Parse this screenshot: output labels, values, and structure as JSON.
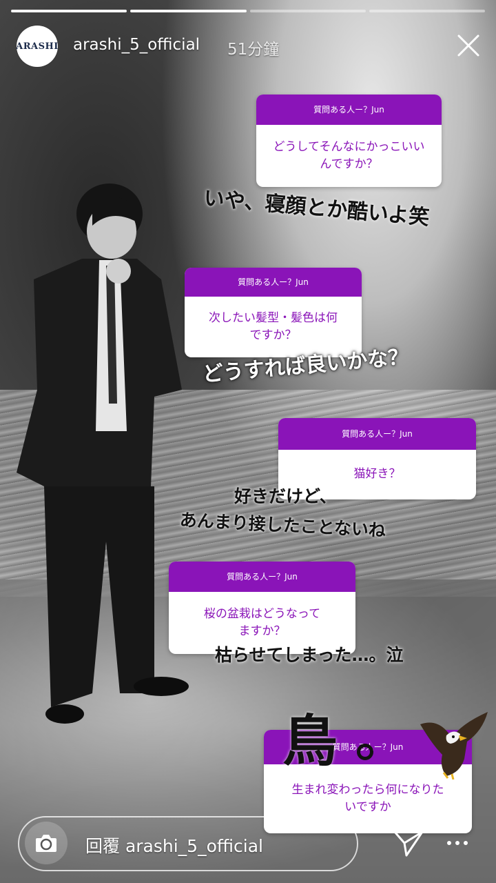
{
  "story": {
    "segments": 4,
    "segments_viewed": 2,
    "username": "arashi_5_official",
    "time_ago": "51分鐘",
    "avatar_text": "ARASHI"
  },
  "question_header": "質問ある人ー？Jun",
  "questions": [
    {
      "header": "質問ある人ー？Jun",
      "text_line1": "どうしてそんなにかっこいい",
      "text_line2": "んですか？"
    },
    {
      "header": "質問ある人ー？Jun",
      "text_line1": "次したい髪型・髪色は何",
      "text_line2": "ですか？"
    },
    {
      "header": "質問ある人ー？Jun",
      "text_line1": "猫好き？",
      "text_line2": ""
    },
    {
      "header": "質問ある人ー？Jun",
      "text_line1": "桜の盆栽はどうなって",
      "text_line2": "ますか？"
    },
    {
      "header": "質問ある人ー？Jun",
      "text_line1": "生まれ変わったら何になりた",
      "text_line2": "いですか"
    }
  ],
  "answers": [
    {
      "line1": "いや、寝顔とか酷いよ笑",
      "line2": ""
    },
    {
      "line1": "どうすれば良いかな？",
      "line2": ""
    },
    {
      "line1": "好きだけど、",
      "line2": "あんまり接したことないね"
    },
    {
      "line1": "枯らせてしまった…。泣",
      "line2": ""
    },
    {
      "line1": "鳥",
      "line2": ""
    }
  ],
  "reply": {
    "placeholder": "回覆 arashi_5_official"
  },
  "colors": {
    "accent_purple": "#8a14b8",
    "text_white": "#ffffff"
  },
  "icons": [
    "close-icon",
    "camera-icon",
    "send-icon",
    "more-icon",
    "eagle-sticker"
  ]
}
